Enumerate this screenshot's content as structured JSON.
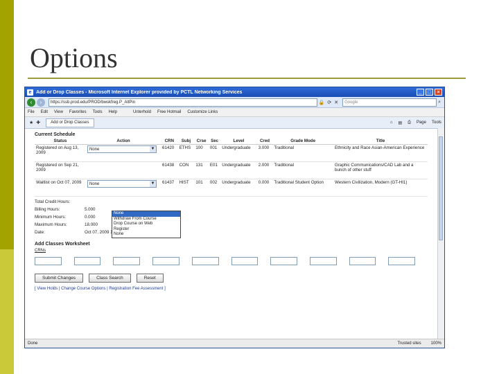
{
  "slide": {
    "title": "Options"
  },
  "window": {
    "title": "Add or Drop Classes - Microsoft Internet Explorer provided by PCTL Networking Services",
    "address": "https://ssb.prod.edu/PROD/bwskfreg.P_AltPin",
    "search_placeholder": "Google",
    "menu": [
      "File",
      "Edit",
      "View",
      "Favorites",
      "Tools",
      "Help"
    ],
    "links_bar": [
      "Unterhold",
      "Free Hotmail",
      "Customize Links"
    ],
    "tab_label": "Add or Drop Classes",
    "toolbar_right": [
      "Page",
      "Tools"
    ]
  },
  "schedule": {
    "heading": "Current Schedule",
    "columns": [
      "Status",
      "Action",
      "CRN",
      "Subj",
      "Crse",
      "Sec",
      "Level",
      "Cred",
      "Grade Mode",
      "Title"
    ],
    "rows": [
      {
        "status": "Registered on Aug 13, 2009",
        "action": "None",
        "crn": "61420",
        "subj": "ETHS",
        "crse": "100",
        "sec": "001",
        "level": "Undergraduate",
        "cred": "3.000",
        "grade_mode": "Traditional",
        "title": "Ethnicity and Race Asian-American Experience"
      },
      {
        "status": "Registered on Sep 21, 2009",
        "action": "",
        "crn": "61438",
        "subj": "CON",
        "crse": "131",
        "sec": "E01",
        "level": "Undergraduate",
        "cred": "2.000",
        "grade_mode": "Traditional",
        "title": "Graphic Communications/CAD Lab and a bunch of other stuff"
      },
      {
        "status": "Waitlist on Oct 07, 2009",
        "action": "None",
        "crn": "61437",
        "subj": "HIST",
        "crse": "101",
        "sec": "002",
        "level": "Undergraduate",
        "cred": "0.000",
        "grade_mode": "Traditional Student Option",
        "title": "Western Civilization, Modern (GT-HI1)"
      }
    ],
    "dropdown_options": [
      "None",
      "Withdraw From Course",
      "Drop Course on Web",
      "Register",
      "None"
    ]
  },
  "totals": [
    {
      "label": "Total Credit Hours:",
      "value": ""
    },
    {
      "label": "Billing Hours:",
      "value": "5.000"
    },
    {
      "label": "Minimum Hours:",
      "value": "0.000"
    },
    {
      "label": "Maximum Hours:",
      "value": "18.000"
    },
    {
      "label": "Date:",
      "value": "Oct 07, 2009 11:03 am"
    }
  ],
  "worksheet": {
    "heading": "Add Classes Worksheet",
    "crn_label": "CRNs"
  },
  "buttons": {
    "submit": "Submit Changes",
    "search": "Class Search",
    "reset": "Reset"
  },
  "footer_links": "[ View Holds | Change Course Options | Registration Fee Assessment ]",
  "status": {
    "left": "Done",
    "zone": "Trusted sites",
    "zoom": "100%"
  }
}
